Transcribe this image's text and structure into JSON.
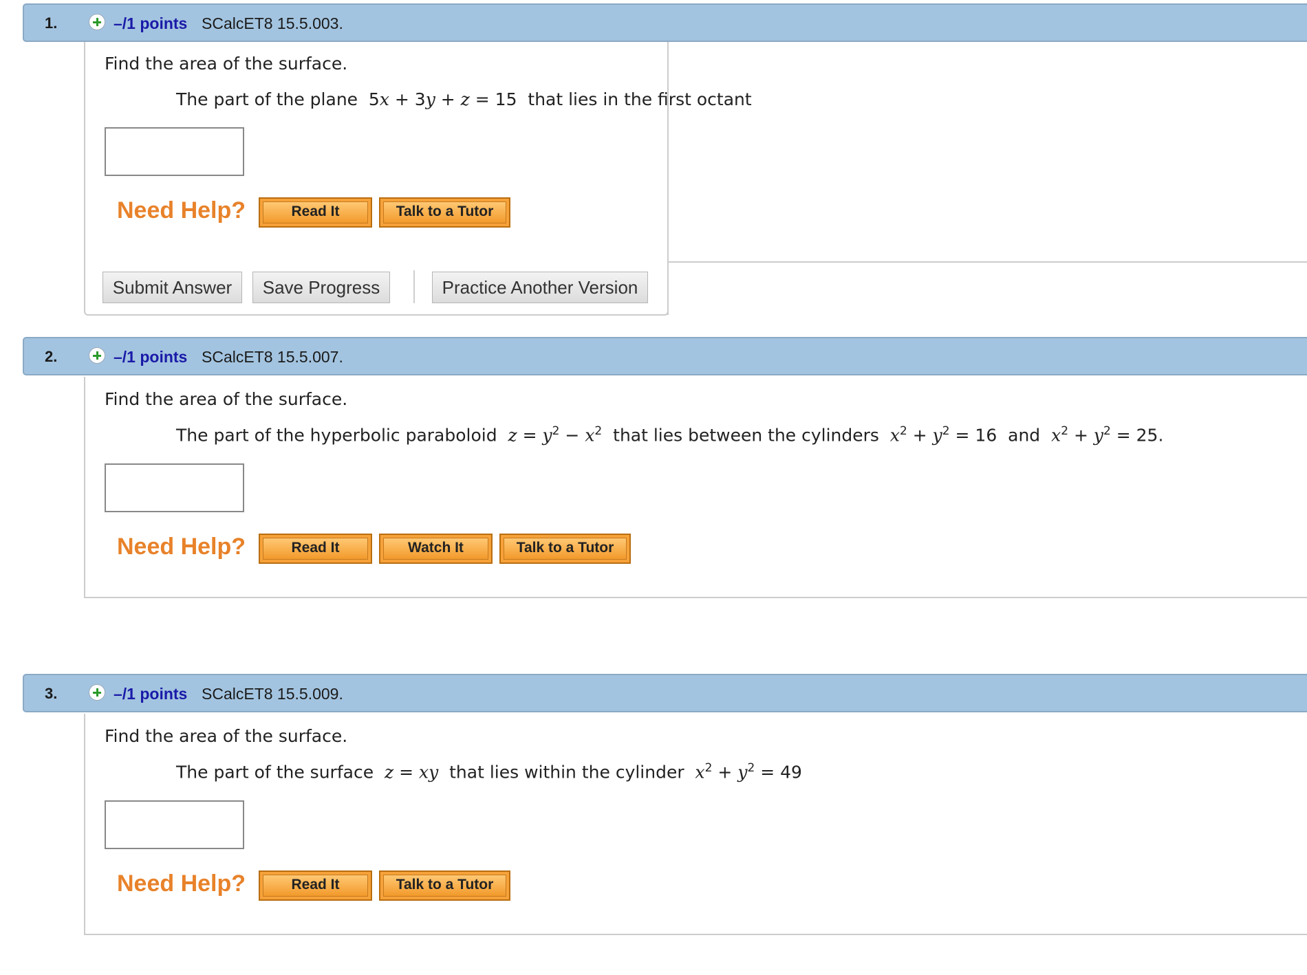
{
  "questions": [
    {
      "number": "1.",
      "points": "–/1 points",
      "code": "SCalcET8 15.5.003.",
      "prompt": "Find the area of the surface.",
      "need_help": "Need Help?",
      "read_it": "Read It",
      "talk_tutor": "Talk to a Tutor",
      "submit": "Submit Answer",
      "save": "Save Progress",
      "practice": "Practice Another Version"
    },
    {
      "number": "2.",
      "points": "–/1 points",
      "code": "SCalcET8 15.5.007.",
      "prompt": "Find the area of the surface.",
      "need_help": "Need Help?",
      "read_it": "Read It",
      "watch_it": "Watch It",
      "talk_tutor": "Talk to a Tutor"
    },
    {
      "number": "3.",
      "points": "–/1 points",
      "code": "SCalcET8 15.5.009.",
      "prompt": "Find the area of the surface.",
      "need_help": "Need Help?",
      "read_it": "Read It",
      "talk_tutor": "Talk to a Tutor"
    }
  ],
  "colors": {
    "header_bg": "#a3c4e0",
    "points_text": "#1a1aa8",
    "need_help": "#e8822a",
    "help_button": "#f6a23a"
  },
  "icons": [
    "plus-icon"
  ]
}
